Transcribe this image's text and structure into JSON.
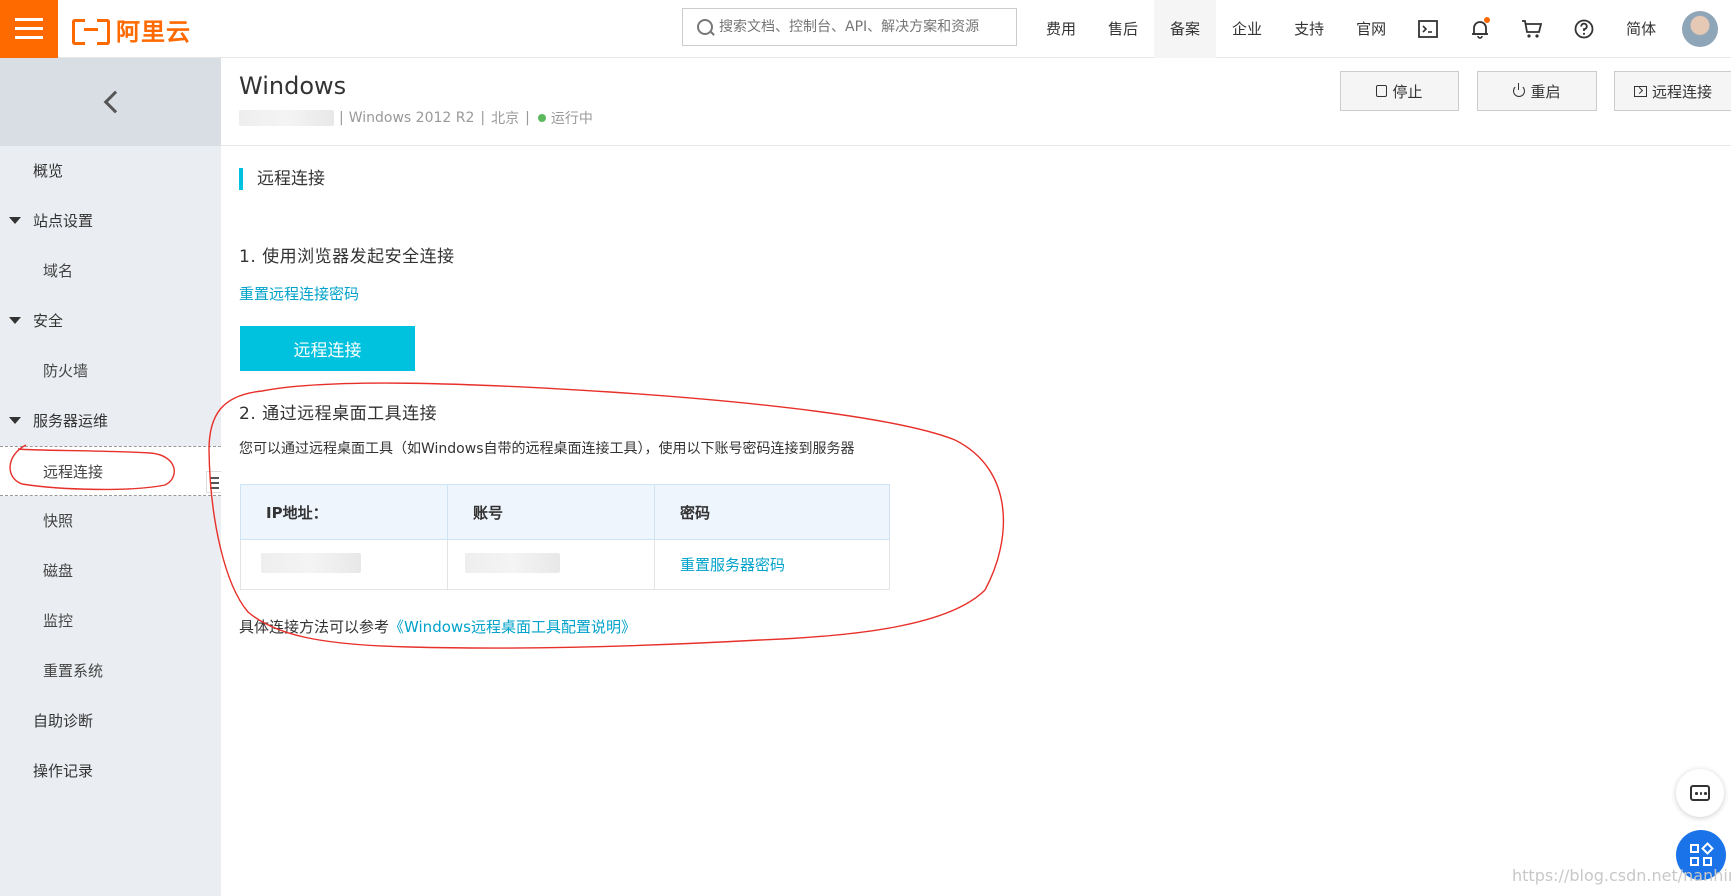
{
  "header": {
    "logo_text": "阿里云",
    "search_placeholder": "搜索文档、控制台、API、解决方案和资源",
    "nav": [
      "费用",
      "售后",
      "备案",
      "企业",
      "支持",
      "官网"
    ],
    "lang": "简体"
  },
  "sidebar": {
    "items": [
      {
        "label": "概览"
      },
      {
        "label": "站点设置"
      },
      {
        "label": "域名"
      },
      {
        "label": "安全"
      },
      {
        "label": "防火墙"
      },
      {
        "label": "服务器运维"
      },
      {
        "label": "远程连接"
      },
      {
        "label": "快照"
      },
      {
        "label": "磁盘"
      },
      {
        "label": "监控"
      },
      {
        "label": "重置系统"
      },
      {
        "label": "自助诊断"
      },
      {
        "label": "操作记录"
      }
    ]
  },
  "instance": {
    "title": "Windows",
    "os": "Windows 2012 R2",
    "region": "北京",
    "status": "运行中",
    "sep": "|"
  },
  "actions": {
    "stop": "停止",
    "restart": "重启",
    "remote": "远程连接"
  },
  "main": {
    "section_title": "远程连接",
    "step1": "1. 使用浏览器发起安全连接",
    "reset_remote_pwd": "重置远程连接密码",
    "connect_button": "远程连接",
    "step2": "2. 通过远程桌面工具连接",
    "desc": "您可以通过远程桌面工具（如Windows自带的远程桌面连接工具），使用以下账号密码连接到服务器",
    "table": {
      "headers": [
        "IP地址：",
        "账号",
        "密码"
      ],
      "reset_server_pwd": "重置服务器密码"
    },
    "ref_prefix": "具体连接方法可以参考",
    "ref_link": "《Windows远程桌面工具配置说明》"
  },
  "watermark": "https://blog.csdn.net/nanhina",
  "colors": {
    "brand": "#ff6a00",
    "accent": "#00c1de",
    "link": "#00a2ca",
    "annotation": "#e8302a"
  }
}
